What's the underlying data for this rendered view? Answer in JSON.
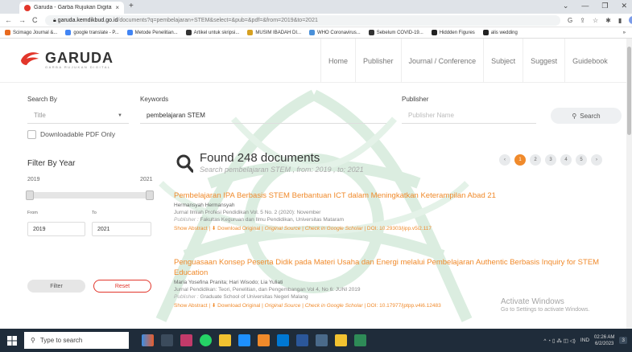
{
  "browser": {
    "tab_title": "Garuda - Garba Rujukan Digital",
    "tab_close": "×",
    "new_tab": "+",
    "url_host": "garuda.kemdikbud.go.id",
    "url_path": "/documents?q=pembelajaran+STEM&select=&pub=&pdf=&from=2019&to=2021",
    "bookmarks": [
      {
        "label": "Scimago Journal &...",
        "color": "#e86a1f"
      },
      {
        "label": "google translate - P...",
        "color": "#4285f4"
      },
      {
        "label": "Metode Penelitian...",
        "color": "#4285f4"
      },
      {
        "label": "Artikel untuk skripsi...",
        "color": "#333333"
      },
      {
        "label": "MUSIM IBADAH DI...",
        "color": "#d6a021"
      },
      {
        "label": "WHO Coronavirus...",
        "color": "#4a90d9"
      },
      {
        "label": "Sebelum COVID-19...",
        "color": "#333333"
      },
      {
        "label": "Hiddden Figures",
        "color": "#222222"
      },
      {
        "label": "alis wedding",
        "color": "#222222"
      }
    ],
    "bookmarks_more": "»"
  },
  "site": {
    "logo_text": "GARUDA",
    "logo_sub": "GARBA RUJUKAN DIGITAL",
    "menu": [
      "Home",
      "Publisher",
      "Journal / Conference",
      "Subject",
      "Suggest",
      "Guidebook"
    ]
  },
  "search": {
    "search_by_label": "Search By",
    "search_by_value": "Title",
    "keywords_label": "Keywords",
    "keywords_value": "pembelajaran STEM",
    "publisher_label": "Publisher",
    "publisher_placeholder": "Publisher Name",
    "search_button": "Search",
    "pdf_only_label": "Downloadable PDF Only"
  },
  "filter": {
    "title": "Filter By Year",
    "min_year": "2019",
    "max_year": "2021",
    "from_label": "From",
    "to_label": "To",
    "from_value": "2019",
    "to_value": "2021",
    "filter_button": "Filter",
    "reset_button": "Reset"
  },
  "results": {
    "found_text": "Found 248 documents",
    "subtitle": "Search pembelajaran STEM , from: 2019 , to: 2021",
    "pages": [
      "‹",
      "1",
      "2",
      "3",
      "4",
      "5",
      "›"
    ],
    "active_page": "1",
    "items": [
      {
        "title": "Pembelajaran IPA Berbasis STEM Berbantuan ICT dalam Meningkatkan Keterampilan Abad 21",
        "authors": "Hermansyah Hermansyah",
        "journal": "Jurnal Ilmiah Profesi Pendidikan Vol. 5 No. 2 (2020): November",
        "publisher_label": "Publisher :",
        "publisher": "Fakultas Keguruan dan Ilmu Pendidikan, Universitas Mataram",
        "show_abstract": "Show Abstract",
        "download": "Download Original",
        "original_source": "Original Source",
        "scholar": "Check in Google Scholar",
        "doi": "DOI: 10.29303/jipp.v5i2.117"
      },
      {
        "title": "Penguasaan Konsep Peserta Didik pada Materi Usaha dan Energi melalui Pembelajaran Authentic Berbasis Inquiry for STEM Education",
        "authors": "Maria Yosefina Pranita; Hari Wisodo; Lia Yuliati",
        "journal": "Jurnal Pendidikan: Teori, Penelitian, dan Pengembangan Vol 4, No 6: JUNI 2019",
        "publisher_label": "Publisher :",
        "publisher": "Graduate School of Universitas Negeri Malang",
        "show_abstract": "Show Abstract",
        "download": "Download Original",
        "original_source": "Original Source",
        "scholar": "Check in Google Scholar",
        "doi": "DOI: 10.17977/jptpp.v4i6.12483"
      }
    ]
  },
  "activate_windows": {
    "line1": "Activate Windows",
    "line2": "Go to Settings to activate Windows."
  },
  "taskbar": {
    "search_placeholder": "Type to search",
    "time": "02:26 AM",
    "date": "6/2/2023",
    "lang": "IND",
    "notif_count": "3"
  },
  "colors": {
    "accent": "#f08a2b",
    "logo_red": "#e2362b",
    "taskbar": "#1f2c3a"
  }
}
